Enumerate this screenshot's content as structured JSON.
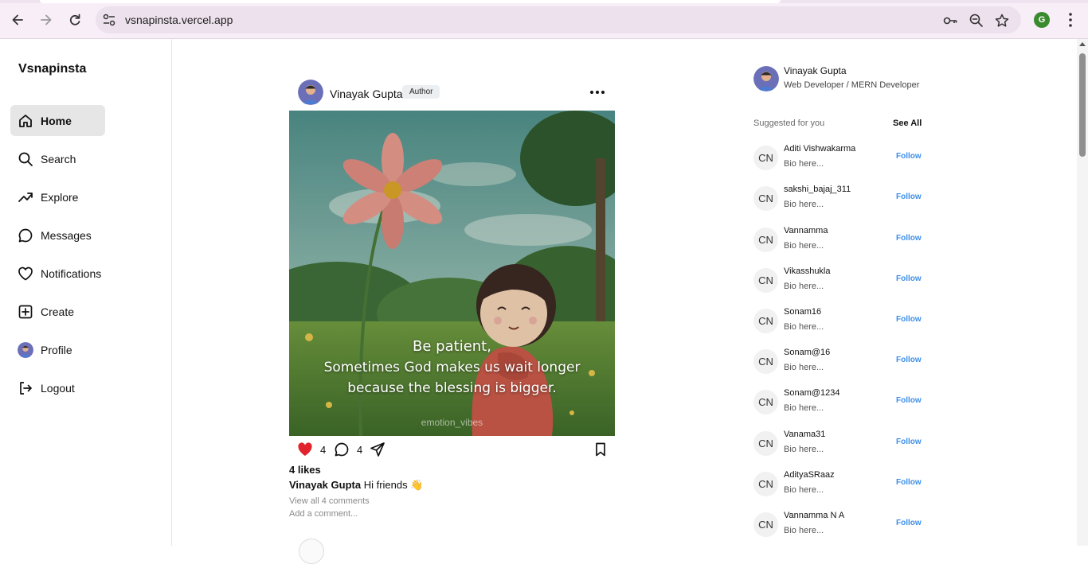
{
  "browser": {
    "url": "vsnapinsta.vercel.app",
    "profile_initial": "G"
  },
  "app": {
    "brand": "Vsnapinsta"
  },
  "sidebar": {
    "items": [
      {
        "label": "Home",
        "icon": "home-icon",
        "active": true
      },
      {
        "label": "Search",
        "icon": "search-icon"
      },
      {
        "label": "Explore",
        "icon": "trending-icon"
      },
      {
        "label": "Messages",
        "icon": "message-icon"
      },
      {
        "label": "Notifications",
        "icon": "heart-icon"
      },
      {
        "label": "Create",
        "icon": "plus-square-icon"
      },
      {
        "label": "Profile",
        "icon": "avatar"
      },
      {
        "label": "Logout",
        "icon": "logout-icon"
      }
    ]
  },
  "post": {
    "author": "Vinayak Gupta",
    "badge": "Author",
    "quote_line1": "Be patient,",
    "quote_line2": "Sometimes God makes us wait longer",
    "quote_line3": "because the blessing is bigger.",
    "watermark": "emotion_vibes",
    "like_count": "4",
    "comment_count": "4",
    "likes_text": "4 likes",
    "caption_author": "Vinayak Gupta",
    "caption_text": "Hi friends 👋",
    "view_comments": "View all 4 comments",
    "add_comment": "Add a comment..."
  },
  "current_user": {
    "name": "Vinayak Gupta",
    "bio": "Web Developer / MERN Developer"
  },
  "suggestions": {
    "label": "Suggested for you",
    "see_all": "See All",
    "initials": "CN",
    "follow_label": "Follow",
    "users": [
      {
        "name": "Aditi Vishwakarma",
        "bio": "Bio here..."
      },
      {
        "name": "sakshi_bajaj_311",
        "bio": "Bio here..."
      },
      {
        "name": "Vannamma",
        "bio": "Bio here..."
      },
      {
        "name": "Vikasshukla",
        "bio": "Bio here..."
      },
      {
        "name": "Sonam16",
        "bio": "Bio here..."
      },
      {
        "name": "Sonam@16",
        "bio": "Bio here..."
      },
      {
        "name": "Sonam@1234",
        "bio": "Bio here..."
      },
      {
        "name": "Vanama31",
        "bio": "Bio here..."
      },
      {
        "name": "AdityaSRaaz",
        "bio": "Bio here..."
      },
      {
        "name": "Vannamma N A",
        "bio": "Bio here..."
      }
    ]
  },
  "colors": {
    "accent_follow": "#3d8ee8",
    "like_red": "#e0232c"
  }
}
